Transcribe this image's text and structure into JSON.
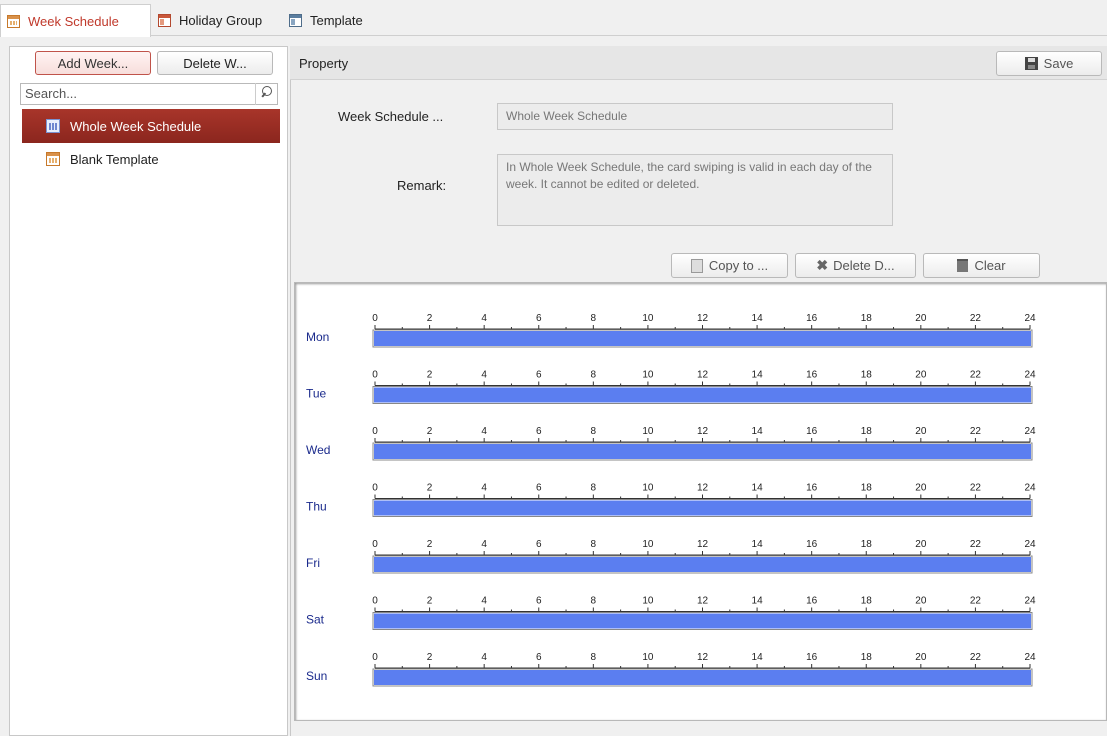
{
  "tabs": [
    {
      "label": "Week Schedule",
      "icon": "calendar-icon",
      "active": true
    },
    {
      "label": "Holiday Group",
      "icon": "holiday-group-icon",
      "active": false
    },
    {
      "label": "Template",
      "icon": "template-icon",
      "active": false
    }
  ],
  "sidebar": {
    "add_label": "Add Week...",
    "delete_label": "Delete W...",
    "search_placeholder": "Search...",
    "items": [
      {
        "label": "Whole Week Schedule",
        "selected": true
      },
      {
        "label": "Blank Template",
        "selected": false
      }
    ]
  },
  "property": {
    "title": "Property",
    "save_label": "Save",
    "name_label": "Week Schedule ...",
    "name_value": "Whole Week Schedule",
    "remark_label": "Remark:",
    "remark_value": "In Whole Week Schedule, the card swiping is valid in each day of the week. It cannot be edited or deleted."
  },
  "actions": {
    "copy_label": "Copy to ...",
    "delete_label": "Delete D...",
    "clear_label": "Clear"
  },
  "schedule": {
    "ticks": [
      "0",
      "2",
      "4",
      "6",
      "8",
      "10",
      "12",
      "14",
      "16",
      "18",
      "20",
      "22",
      "24"
    ],
    "bar_color": "#5b7ef0",
    "days": [
      {
        "label": "Mon",
        "start": 0,
        "end": 24
      },
      {
        "label": "Tue",
        "start": 0,
        "end": 24
      },
      {
        "label": "Wed",
        "start": 0,
        "end": 24
      },
      {
        "label": "Thu",
        "start": 0,
        "end": 24
      },
      {
        "label": "Fri",
        "start": 0,
        "end": 24
      },
      {
        "label": "Sat",
        "start": 0,
        "end": 24
      },
      {
        "label": "Sun",
        "start": 0,
        "end": 24
      }
    ]
  },
  "colors": {
    "accent": "#c0392b",
    "selection": "#9b2e24"
  }
}
